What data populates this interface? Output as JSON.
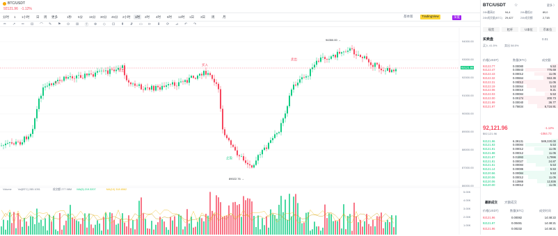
{
  "header": {
    "symbol": "BTC/USDT",
    "price": "92121.96",
    "change": "-1.12%"
  },
  "toolbar": {
    "row1": [
      "分时",
      "1",
      "1小时",
      "日",
      "周",
      "更多"
    ],
    "intervals": [
      "1秒",
      "5分",
      "15分",
      "30分",
      "45分",
      "2小时",
      "1时",
      "2时",
      "4时",
      "6时",
      "12时",
      "1日",
      "3日",
      "周",
      "月"
    ],
    "active_interval": "1时",
    "right": [
      "基本版",
      "TradingView",
      "深度"
    ]
  },
  "drawtools": [
    "✏",
    "↗",
    "═",
    "⊟",
    "⌒",
    "✎",
    "⚑",
    "⊙",
    "⊞",
    "Ⓣ",
    "⊕",
    "◇",
    "⊡",
    "⬆",
    "⇵",
    "▭",
    "⊳",
    "⬇",
    "⟳",
    "⊿",
    "↶",
    "↷"
  ],
  "chart": {
    "price_labels": [
      "94000.00",
      "93000.00",
      "92000.00",
      "91000.00",
      "90000.00",
      "89000.00",
      "88000.00",
      "87000.00",
      "86000.00"
    ],
    "current_price": "92121.96",
    "high_label": "94350.00 →",
    "low_label": "89022.76 →",
    "annotations": [
      {
        "text": "买入",
        "color": "#f6465d"
      },
      {
        "text": "卖出",
        "color": "#f6465d"
      },
      {
        "text": "买入",
        "color": "#f6465d"
      },
      {
        "text": "卖出",
        "color": "#f6465d"
      },
      {
        "text": "止盈",
        "color": "#0ecb81"
      }
    ],
    "volume_legend": [
      "Volume",
      "Vol(BTC) 285.1051",
      "成交额 277.98M",
      "MA(5) 219.3207",
      "MA(10) 318.6562"
    ],
    "volume_labels": [
      "5.00K",
      "4.00K",
      "3.00K",
      "2.00K",
      "1.00K"
    ],
    "up_color": "#0ecb81",
    "down_color": "#f6465d"
  },
  "right": {
    "title": "BTC/USDT",
    "fav": "☆",
    "stats": [
      {
        "label": "24h最高价",
        "value": "94,4"
      },
      {
        "label": "24h最低价",
        "value": "89,0"
      },
      {
        "label": "24h成交量(BTC)",
        "value": "29,427"
      },
      {
        "label": "24h成交额",
        "value": "2,71B"
      }
    ],
    "buttons": [
      "现货",
      "杠杆",
      "U本位",
      "币本位"
    ],
    "orderbook_title": "买卖盘",
    "ob_tabs": [
      "0.01",
      "更多"
    ],
    "ob_sub": [
      "限价",
      "买入 41.5%",
      "卖出 58.5%"
    ],
    "ob_headers": [
      "价格(USDT)",
      "数量(BTC)",
      "成交额"
    ],
    "asks": [
      [
        "92122.77",
        "0.00080",
        "5.53"
      ],
      [
        "92122.47",
        "0.00843",
        "776.69"
      ],
      [
        "92122.43",
        "0.00012",
        "11.05"
      ],
      [
        "92122.32",
        "0.00664",
        "553.36"
      ],
      [
        "92122.31",
        "0.00012",
        "11.05"
      ],
      [
        "92122.19",
        "0.00064",
        "5.53"
      ],
      [
        "92122.06",
        "0.00010",
        "9.21"
      ],
      [
        "92122.03",
        "0.00084",
        "5.53"
      ],
      [
        "92122.00",
        "0.00174",
        "200.73"
      ],
      [
        "92121.99",
        "0.00040",
        "36.77"
      ],
      [
        "92121.97",
        "0.75834",
        "6,716.91"
      ]
    ],
    "mid_price": "92,121.96",
    "mid_sub": "$92,121.96",
    "mid_change": "-1.12%",
    "mid_vol": "-1064.73",
    "bids": [
      [
        "92121.96",
        "6.39131",
        "589,330.00"
      ],
      [
        "92121.93",
        "0.00084",
        "5.53"
      ],
      [
        "92121.91",
        "0.00012",
        "11.05"
      ],
      [
        "92121.88",
        "0.00012",
        "11.05"
      ],
      [
        "92121.87",
        "0.01993",
        "1,7996"
      ],
      [
        "92121.81",
        "0.00027",
        "24.87"
      ],
      [
        "92121.61",
        "0.00084",
        "5.53"
      ],
      [
        "92121.14",
        "0.00086",
        "5.53"
      ],
      [
        "92120.56",
        "0.00084",
        "5.53"
      ],
      [
        "92120.06",
        "0.00012",
        "11.05"
      ],
      [
        "92120.06",
        "0.13966",
        "12,836"
      ],
      [
        "92120.00",
        "0.00012",
        "11.05"
      ]
    ],
    "trades_tabs": [
      "最新成交",
      "大额成交"
    ],
    "trades_headers": [
      "价格(USDT)",
      "数量(BTC)",
      "成交时间"
    ],
    "trades": [
      [
        "92121.96",
        "0.00082",
        "14:48:22"
      ],
      [
        "92121.97",
        "0.00481",
        "14:48:21"
      ],
      [
        "92121.96",
        "0.00232",
        "14:48:21"
      ]
    ]
  }
}
